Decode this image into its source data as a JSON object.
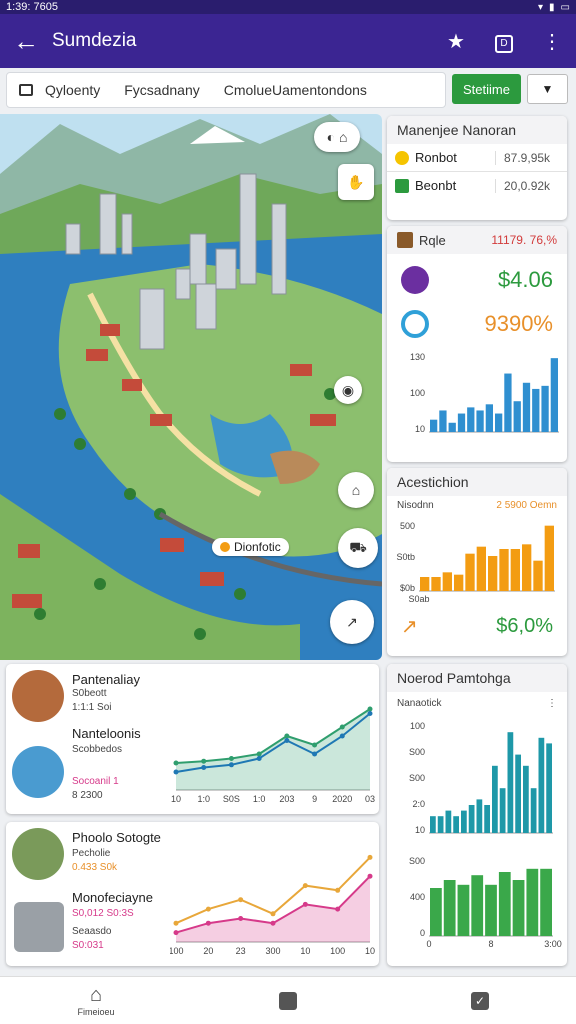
{
  "status": {
    "time": "1:39: 7605"
  },
  "appbar": {
    "title": "Sumdezia"
  },
  "tabs": [
    {
      "label": "Qyloenty"
    },
    {
      "label": "Fycsadnany"
    },
    {
      "label": "CmolueUamentondons"
    }
  ],
  "status_button": "Stetiime",
  "map": {
    "place_label": "Dionfotic"
  },
  "side_top": {
    "title": "Manenjee Nanoran",
    "rows": [
      {
        "label": "Ronbot",
        "value": "87.9,95k"
      },
      {
        "label": "Beonbt",
        "value": "20,0.92k"
      }
    ]
  },
  "role": {
    "title": "Rqle",
    "value": "11179. 76,%",
    "metric1": "$4.06",
    "metric2": "9390%",
    "y_ticks": [
      "130",
      "100",
      "10"
    ]
  },
  "acest": {
    "title": "Acestichion",
    "sub_label": "Nisodnn",
    "sub_value": "2 5900 Oemn",
    "y_ticks": [
      "500",
      "S0tb",
      "$0b"
    ],
    "x_label": "S0ab",
    "metric": "$6,0%"
  },
  "panel1": {
    "title": "Pantenaliay",
    "sub": "S0beott",
    "stat": "1:1:1 Soi",
    "item2_title": "Nanteloonis",
    "item2_sub": "Scobbedos",
    "item2_stat": "Socoanil 1",
    "item2_val": "8 2300",
    "x_ticks": [
      "10",
      "1:0",
      "S0S",
      "1:0",
      "203",
      "9",
      "2020",
      "03"
    ]
  },
  "panel2": {
    "title": "Phoolo Sotogte",
    "sub": "Pecholie",
    "stat": "0.433 S0k",
    "item2_title": "Monofeciayne",
    "item2_sub": "S0,012 S0:3S",
    "item2_stat": "Seaasdo",
    "item2_val": "S0:031",
    "x_ticks": [
      "100",
      "20",
      "23",
      "300",
      "10",
      "100",
      "10"
    ]
  },
  "right_panel": {
    "title": "Noerod Pamtohga",
    "sub": "Nanaotick",
    "y_ticks_top": [
      "100",
      "S00",
      "S00",
      "2:0",
      "10"
    ],
    "y_ticks_bot": [
      "S00",
      "400",
      "0"
    ],
    "x_ticks": [
      "0",
      "8",
      "3:00"
    ]
  },
  "nav": {
    "home_label": "Fimeioeu"
  },
  "chart_data": [
    {
      "type": "bar",
      "title": "Rqle",
      "categories": [
        "1",
        "2",
        "3",
        "4",
        "5",
        "6",
        "7",
        "8",
        "9",
        "10",
        "11",
        "12",
        "13",
        "14"
      ],
      "values": [
        20,
        35,
        15,
        30,
        40,
        35,
        45,
        30,
        95,
        50,
        80,
        70,
        75,
        120
      ],
      "ylim": [
        0,
        130
      ],
      "color": "#2f8fd0"
    },
    {
      "type": "bar",
      "title": "Acestichion",
      "categories": [
        "1",
        "2",
        "3",
        "4",
        "5",
        "6",
        "7",
        "8",
        "9",
        "10",
        "11",
        "12"
      ],
      "values": [
        60,
        60,
        80,
        70,
        160,
        190,
        150,
        180,
        180,
        200,
        130,
        280
      ],
      "ylim": [
        0,
        300
      ],
      "color": "#f39c12"
    },
    {
      "type": "line",
      "title": "Pantenaliay",
      "x": [
        "10",
        "1:0",
        "S0S",
        "1:0",
        "203",
        "9",
        "2020",
        "03"
      ],
      "series": [
        {
          "values": [
            30,
            32,
            35,
            40,
            60,
            50,
            70,
            90
          ],
          "color": "#2f9e6e"
        },
        {
          "values": [
            20,
            25,
            28,
            35,
            55,
            40,
            60,
            85
          ],
          "color": "#1f78b4"
        }
      ],
      "ylim": [
        0,
        100
      ]
    },
    {
      "type": "line",
      "title": "Phoolo Sotogte",
      "x": [
        "100",
        "20",
        "23",
        "300",
        "10",
        "100",
        "10"
      ],
      "series": [
        {
          "values": [
            20,
            35,
            45,
            30,
            60,
            55,
            90
          ],
          "color": "#e8a73a"
        },
        {
          "values": [
            10,
            20,
            25,
            20,
            40,
            35,
            70
          ],
          "color": "#d63a8a"
        }
      ],
      "ylim": [
        0,
        100
      ]
    },
    {
      "type": "bar",
      "title": "Noerod Pamtohga",
      "categories": [
        "1",
        "2",
        "3",
        "4",
        "5",
        "6",
        "7",
        "8",
        "9",
        "10",
        "11",
        "12",
        "13",
        "14",
        "15",
        "16"
      ],
      "values": [
        15,
        15,
        20,
        15,
        20,
        25,
        30,
        25,
        60,
        40,
        90,
        70,
        60,
        40,
        85,
        80
      ],
      "ylim": [
        0,
        100
      ],
      "color": "#1e98a8"
    },
    {
      "type": "bar",
      "title": "Noerod Pamtohga (lower)",
      "categories": [
        "1",
        "2",
        "3",
        "4",
        "5",
        "6",
        "7",
        "8",
        "9"
      ],
      "values": [
        300,
        350,
        320,
        380,
        320,
        400,
        350,
        420,
        420
      ],
      "ylim": [
        0,
        500
      ],
      "color": "#3aa84a"
    }
  ]
}
